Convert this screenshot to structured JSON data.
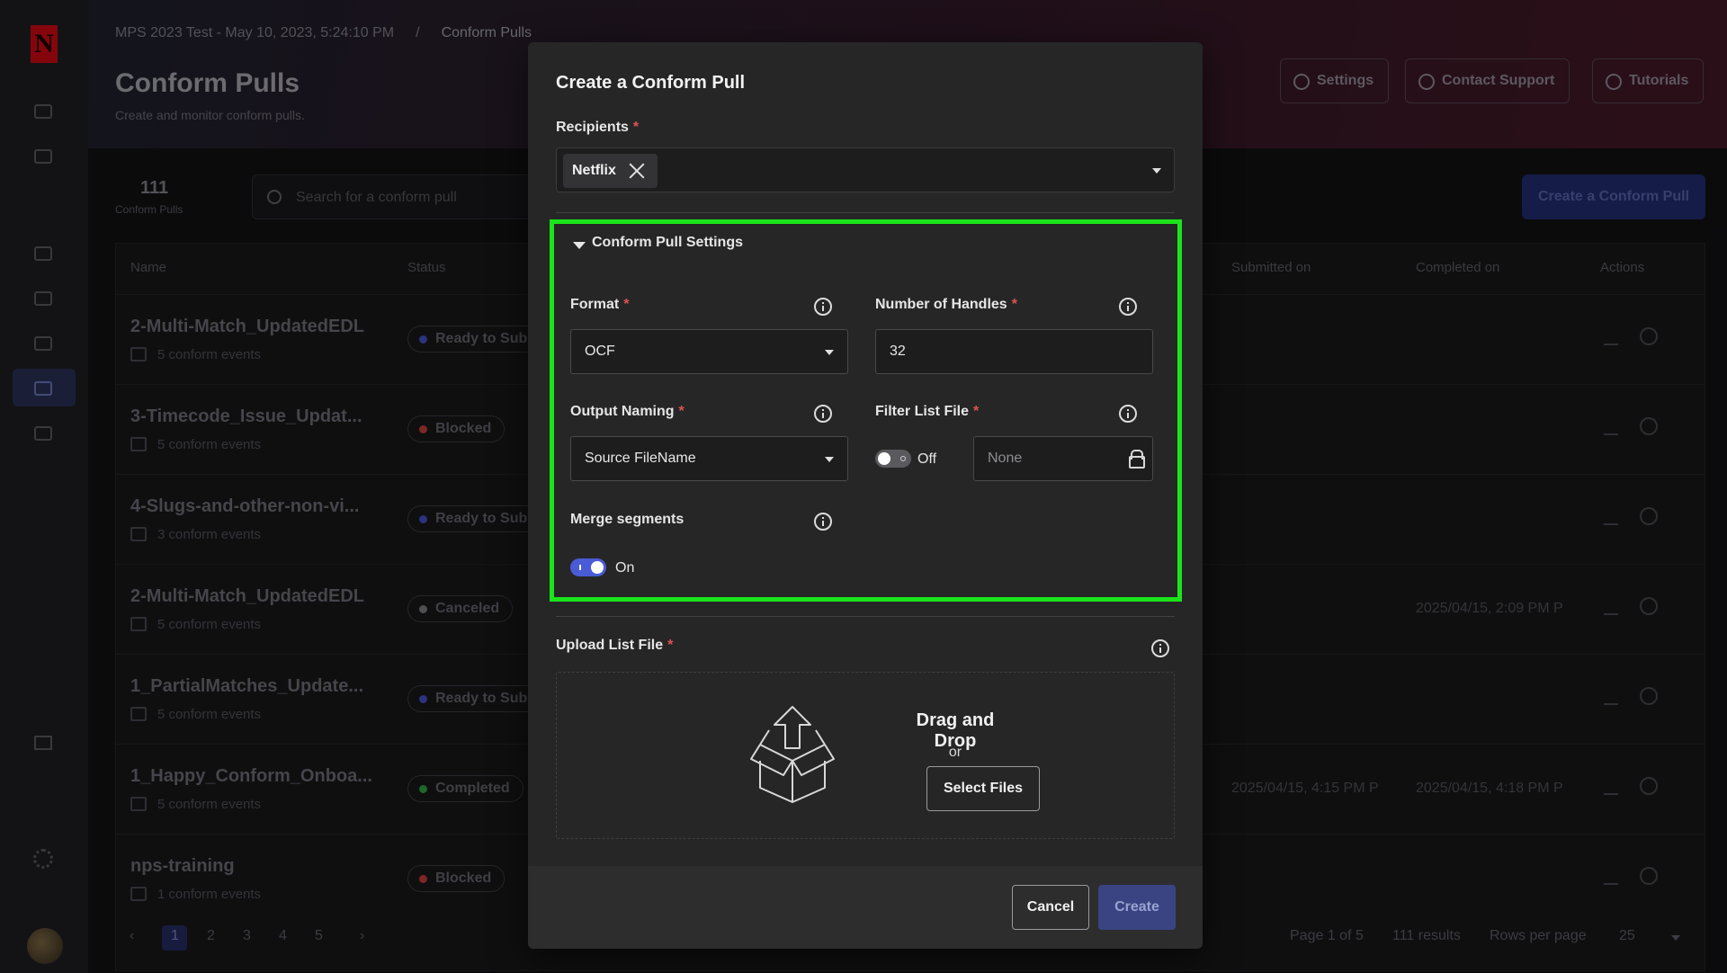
{
  "app": {
    "logo_letter": "N",
    "breadcrumb": [
      "MPS 2023 Test - May 10, 2023, 5:24:10 PM",
      "Conform Pulls"
    ],
    "breadcrumb_separator": "/",
    "page_title": "Conform Pulls",
    "page_subtitle": "Create and monitor conform pulls.",
    "header_buttons": {
      "settings": "Settings",
      "contact": "Contact Support",
      "tutorials": "Tutorials"
    },
    "stats": {
      "count": "111",
      "label": "Conform Pulls"
    },
    "search_placeholder": "Search for a conform pull",
    "create_button": "Create a Conform Pull",
    "columns": [
      "Name",
      "Status",
      "Submitted on",
      "Completed on",
      "Actions"
    ],
    "rows": [
      {
        "name": "2-Multi-Match_UpdatedEDL",
        "events": "5 conform events",
        "status": "Ready to Sub",
        "status_color": "#3a43a8",
        "submitted": "",
        "completed": ""
      },
      {
        "name": "3-Timecode_Issue_Updat...",
        "events": "5 conform events",
        "status": "Blocked",
        "status_color": "#a83232",
        "submitted": "",
        "completed": ""
      },
      {
        "name": "4-Slugs-and-other-non-vi...",
        "events": "3 conform events",
        "status": "Ready to Sub",
        "status_color": "#3a43a8",
        "submitted": "",
        "completed": ""
      },
      {
        "name": "2-Multi-Match_UpdatedEDL",
        "events": "5 conform events",
        "status": "Canceled",
        "status_color": "#6a6a6e",
        "submitted": "",
        "completed": "2025/04/15, 2:09 PM P"
      },
      {
        "name": "1_PartialMatches_Update...",
        "events": "5 conform events",
        "status": "Ready to Sub",
        "status_color": "#3a43a8",
        "submitted": "",
        "completed": ""
      },
      {
        "name": "1_Happy_Conform_Onboa...",
        "events": "5 conform events",
        "status": "Completed",
        "status_color": "#2a8a3a",
        "submitted": "2025/04/15, 4:15 PM P",
        "completed": "2025/04/15, 4:18 PM P"
      },
      {
        "name": "nps-training",
        "events": "1 conform events",
        "status": "Blocked",
        "status_color": "#a83232",
        "submitted": "",
        "completed": ""
      }
    ],
    "pagination": {
      "pages": [
        "1",
        "2",
        "3",
        "4",
        "5"
      ],
      "current": "1",
      "summary": "Page 1 of 5",
      "results": "111 results",
      "rows_label": "Rows per page",
      "rows_value": "25"
    }
  },
  "modal": {
    "title": "Create a Conform Pull",
    "recipients": {
      "label": "Recipients",
      "chips": [
        "Netflix"
      ]
    },
    "settings_section": {
      "title": "Conform Pull Settings",
      "format": {
        "label": "Format",
        "value": "OCF"
      },
      "handles": {
        "label": "Number of Handles",
        "value": "32"
      },
      "output_naming": {
        "label": "Output Naming",
        "value": "Source FileName"
      },
      "filter_list": {
        "label": "Filter List File",
        "toggle_state": "Off",
        "value": "None"
      },
      "merge": {
        "label": "Merge segments",
        "toggle_state": "On"
      }
    },
    "upload": {
      "label": "Upload List File",
      "drop_title": "Drag and Drop",
      "or_text": "or",
      "select_button": "Select Files"
    },
    "footer": {
      "cancel": "Cancel",
      "create": "Create"
    },
    "required_mark": "*"
  },
  "colors": {
    "highlight_border": "#1be31b",
    "primary": "#4a5bd6",
    "required": "#e05252"
  }
}
